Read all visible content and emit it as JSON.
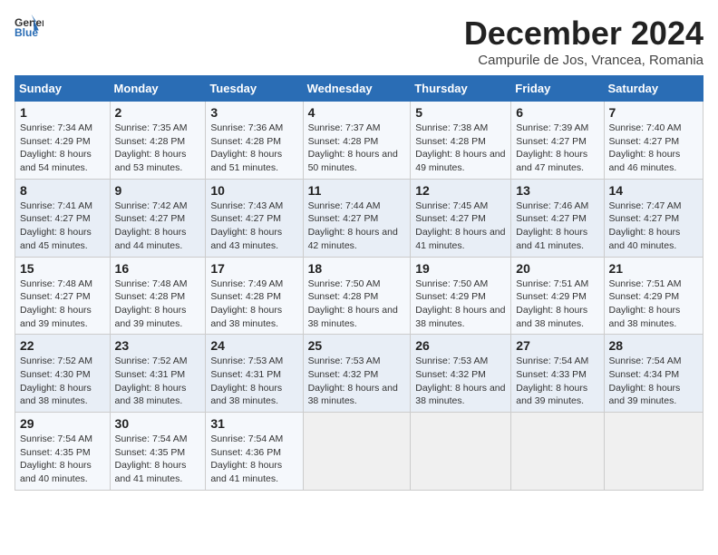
{
  "header": {
    "logo_line1": "General",
    "logo_line2": "Blue",
    "title": "December 2024",
    "subtitle": "Campurile de Jos, Vrancea, Romania"
  },
  "days_of_week": [
    "Sunday",
    "Monday",
    "Tuesday",
    "Wednesday",
    "Thursday",
    "Friday",
    "Saturday"
  ],
  "weeks": [
    [
      {
        "day": 1,
        "sunrise": "7:34 AM",
        "sunset": "4:29 PM",
        "daylight": "8 hours and 54 minutes"
      },
      {
        "day": 2,
        "sunrise": "7:35 AM",
        "sunset": "4:28 PM",
        "daylight": "8 hours and 53 minutes"
      },
      {
        "day": 3,
        "sunrise": "7:36 AM",
        "sunset": "4:28 PM",
        "daylight": "8 hours and 51 minutes"
      },
      {
        "day": 4,
        "sunrise": "7:37 AM",
        "sunset": "4:28 PM",
        "daylight": "8 hours and 50 minutes"
      },
      {
        "day": 5,
        "sunrise": "7:38 AM",
        "sunset": "4:28 PM",
        "daylight": "8 hours and 49 minutes"
      },
      {
        "day": 6,
        "sunrise": "7:39 AM",
        "sunset": "4:27 PM",
        "daylight": "8 hours and 47 minutes"
      },
      {
        "day": 7,
        "sunrise": "7:40 AM",
        "sunset": "4:27 PM",
        "daylight": "8 hours and 46 minutes"
      }
    ],
    [
      {
        "day": 8,
        "sunrise": "7:41 AM",
        "sunset": "4:27 PM",
        "daylight": "8 hours and 45 minutes"
      },
      {
        "day": 9,
        "sunrise": "7:42 AM",
        "sunset": "4:27 PM",
        "daylight": "8 hours and 44 minutes"
      },
      {
        "day": 10,
        "sunrise": "7:43 AM",
        "sunset": "4:27 PM",
        "daylight": "8 hours and 43 minutes"
      },
      {
        "day": 11,
        "sunrise": "7:44 AM",
        "sunset": "4:27 PM",
        "daylight": "8 hours and 42 minutes"
      },
      {
        "day": 12,
        "sunrise": "7:45 AM",
        "sunset": "4:27 PM",
        "daylight": "8 hours and 41 minutes"
      },
      {
        "day": 13,
        "sunrise": "7:46 AM",
        "sunset": "4:27 PM",
        "daylight": "8 hours and 41 minutes"
      },
      {
        "day": 14,
        "sunrise": "7:47 AM",
        "sunset": "4:27 PM",
        "daylight": "8 hours and 40 minutes"
      }
    ],
    [
      {
        "day": 15,
        "sunrise": "7:48 AM",
        "sunset": "4:27 PM",
        "daylight": "8 hours and 39 minutes"
      },
      {
        "day": 16,
        "sunrise": "7:48 AM",
        "sunset": "4:28 PM",
        "daylight": "8 hours and 39 minutes"
      },
      {
        "day": 17,
        "sunrise": "7:49 AM",
        "sunset": "4:28 PM",
        "daylight": "8 hours and 38 minutes"
      },
      {
        "day": 18,
        "sunrise": "7:50 AM",
        "sunset": "4:28 PM",
        "daylight": "8 hours and 38 minutes"
      },
      {
        "day": 19,
        "sunrise": "7:50 AM",
        "sunset": "4:29 PM",
        "daylight": "8 hours and 38 minutes"
      },
      {
        "day": 20,
        "sunrise": "7:51 AM",
        "sunset": "4:29 PM",
        "daylight": "8 hours and 38 minutes"
      },
      {
        "day": 21,
        "sunrise": "7:51 AM",
        "sunset": "4:29 PM",
        "daylight": "8 hours and 38 minutes"
      }
    ],
    [
      {
        "day": 22,
        "sunrise": "7:52 AM",
        "sunset": "4:30 PM",
        "daylight": "8 hours and 38 minutes"
      },
      {
        "day": 23,
        "sunrise": "7:52 AM",
        "sunset": "4:31 PM",
        "daylight": "8 hours and 38 minutes"
      },
      {
        "day": 24,
        "sunrise": "7:53 AM",
        "sunset": "4:31 PM",
        "daylight": "8 hours and 38 minutes"
      },
      {
        "day": 25,
        "sunrise": "7:53 AM",
        "sunset": "4:32 PM",
        "daylight": "8 hours and 38 minutes"
      },
      {
        "day": 26,
        "sunrise": "7:53 AM",
        "sunset": "4:32 PM",
        "daylight": "8 hours and 38 minutes"
      },
      {
        "day": 27,
        "sunrise": "7:54 AM",
        "sunset": "4:33 PM",
        "daylight": "8 hours and 39 minutes"
      },
      {
        "day": 28,
        "sunrise": "7:54 AM",
        "sunset": "4:34 PM",
        "daylight": "8 hours and 39 minutes"
      }
    ],
    [
      {
        "day": 29,
        "sunrise": "7:54 AM",
        "sunset": "4:35 PM",
        "daylight": "8 hours and 40 minutes"
      },
      {
        "day": 30,
        "sunrise": "7:54 AM",
        "sunset": "4:35 PM",
        "daylight": "8 hours and 41 minutes"
      },
      {
        "day": 31,
        "sunrise": "7:54 AM",
        "sunset": "4:36 PM",
        "daylight": "8 hours and 41 minutes"
      },
      null,
      null,
      null,
      null
    ]
  ]
}
